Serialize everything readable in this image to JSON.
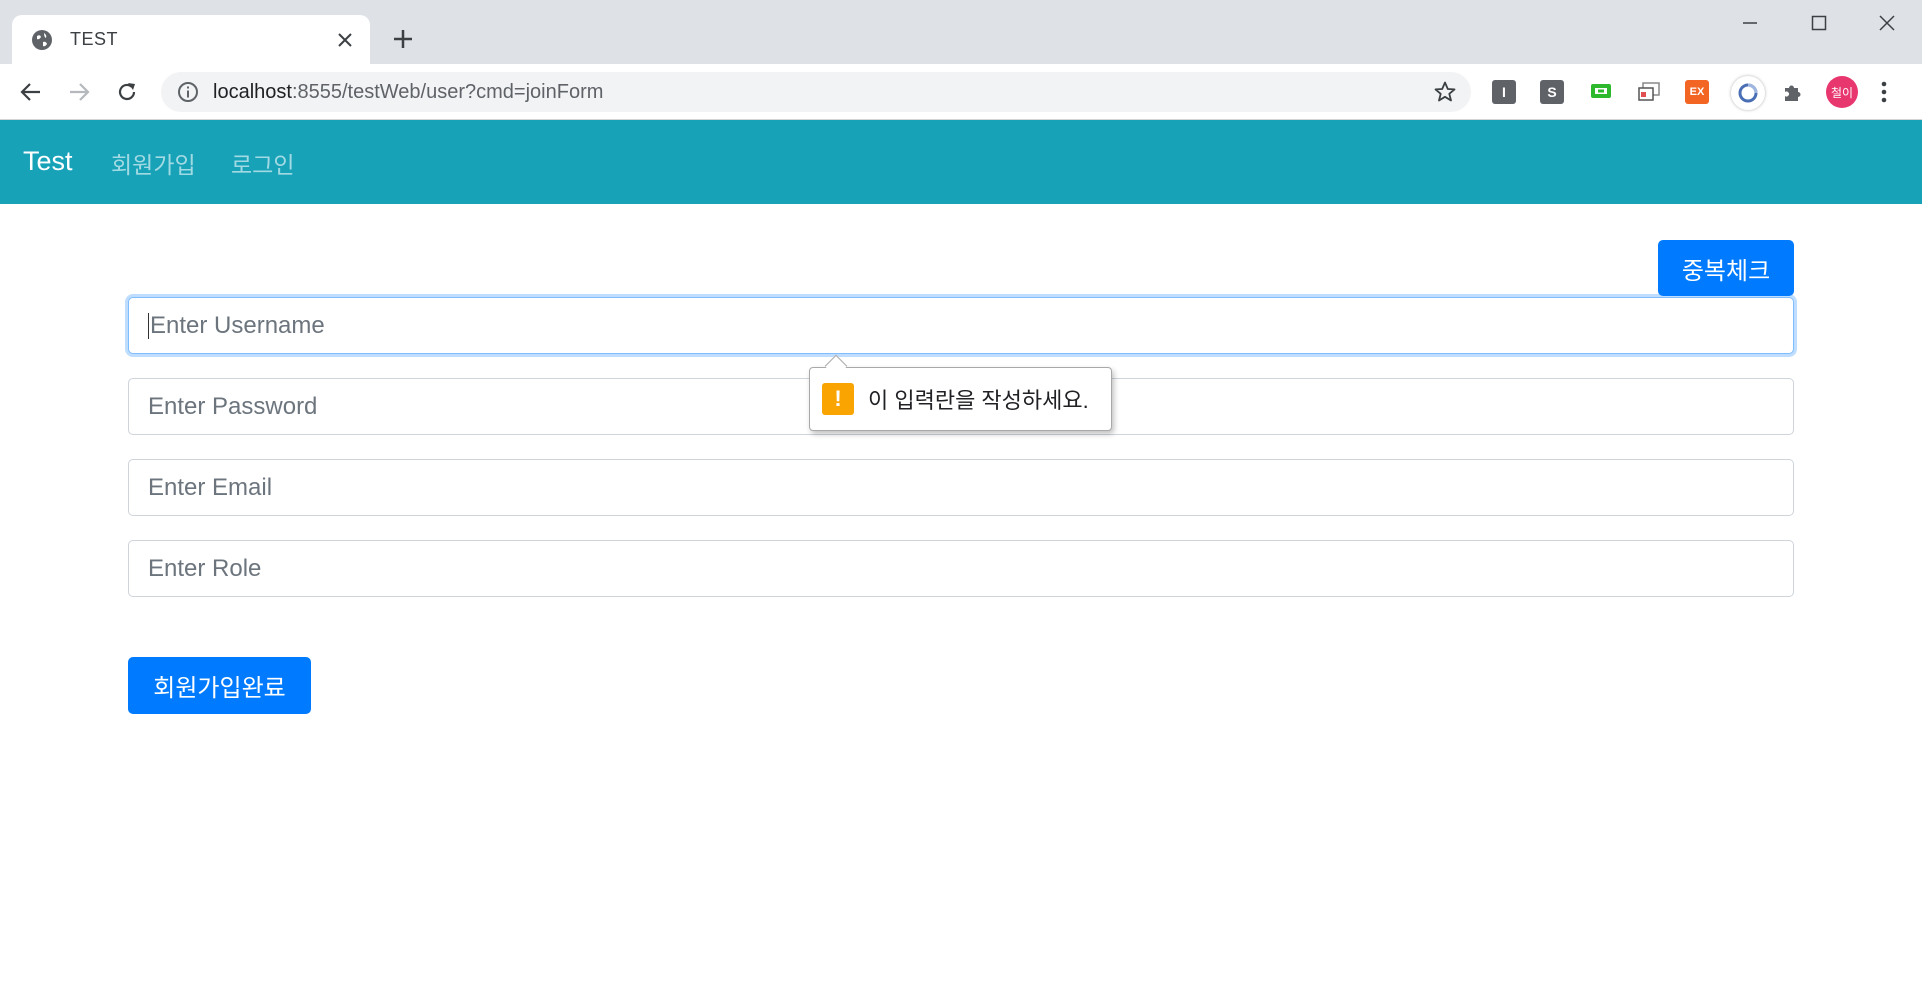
{
  "browser": {
    "tab_title": "TEST",
    "url_host": "localhost",
    "url_rest": ":8555/testWeb/user?cmd=joinForm",
    "extensions": [
      {
        "icon": "I",
        "color": "#5f6368"
      },
      {
        "icon": "S",
        "color": "#5f6368"
      },
      {
        "icon": "",
        "color": "#2eb82e"
      },
      {
        "icon": "",
        "color": "#888888"
      },
      {
        "icon": "EX",
        "color": "#f26522"
      }
    ],
    "profile_label": "철이"
  },
  "navbar": {
    "brand": "Test",
    "links": [
      "회원가입",
      "로그인"
    ],
    "bg_color": "#17a2b8"
  },
  "form": {
    "dup_check_label": "중복체크",
    "username_placeholder": "Enter Username",
    "password_placeholder": "Enter Password",
    "email_placeholder": "Enter Email",
    "role_placeholder": "Enter Role",
    "submit_label": "회원가입완료",
    "validation_message": "이 입력란을 작성하세요."
  },
  "colors": {
    "primary": "#007bff",
    "warning": "#f9a400"
  }
}
